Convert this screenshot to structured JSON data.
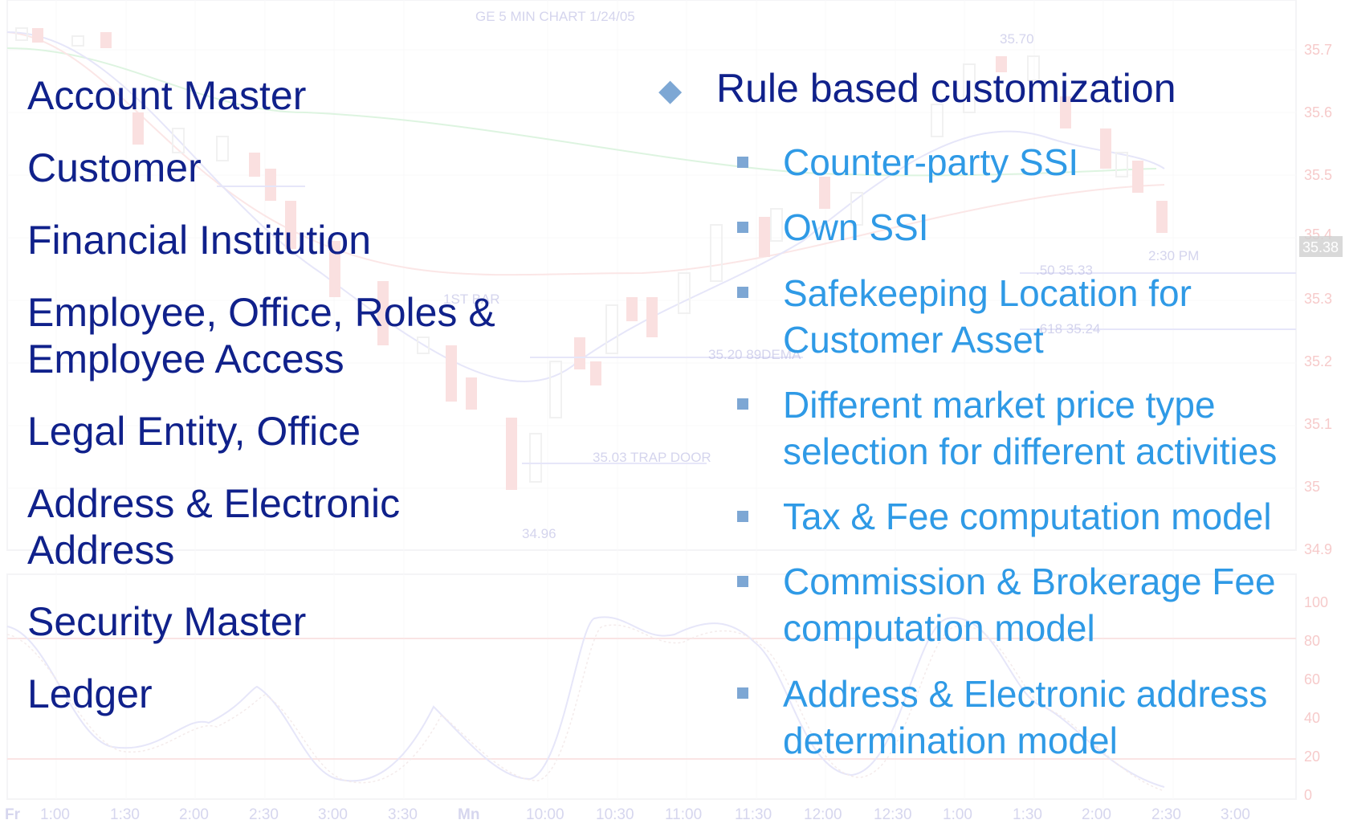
{
  "chart_bg": {
    "title": "GE 5 MIN CHART   1/24/05",
    "price_labels": [
      "35.7",
      "35.6",
      "35.5",
      "35.4",
      "35.3",
      "35.2",
      "35.1",
      "35",
      "34.9"
    ],
    "current_price": "35.38",
    "osc_labels": [
      "100",
      "80",
      "60",
      "40",
      "20",
      "0"
    ],
    "time_labels": [
      "Fr",
      "1:00",
      "1:30",
      "2:00",
      "2:30",
      "3:00",
      "3:30",
      "Mn",
      "10:00",
      "10:30",
      "11:00",
      "11:30",
      "12:00",
      "12:30",
      "1:00",
      "1:30",
      "2:00",
      "2:30",
      "3:00"
    ],
    "annotations": [
      "35.70",
      "1ST BAR",
      "35.20  89DEMA",
      "35.03  TRAP DOOR",
      "34.96",
      "2:30 PM",
      ".50  35.33",
      ".618  35.24"
    ]
  },
  "left_items": [
    "Account Master",
    "Customer",
    "Financial Institution",
    "Employee, Office, Roles & Employee Access",
    "Legal Entity, Office",
    "Address & Electronic Address",
    "Security Master",
    "Ledger"
  ],
  "right": {
    "heading": "Rule based customization",
    "items": [
      "Counter-party SSI",
      "Own SSI",
      "Safekeeping Location for Customer Asset",
      "Different market price type selection for different activities",
      "Tax & Fee computation model",
      "Commission & Brokerage Fee computation model",
      "Address & Electronic address determination model"
    ]
  }
}
